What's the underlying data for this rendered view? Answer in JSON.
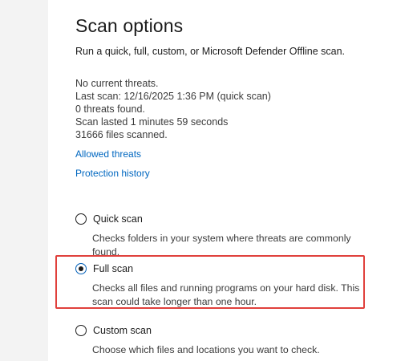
{
  "page": {
    "title": "Scan options",
    "subtitle": "Run a quick, full, custom, or Microsoft Defender Offline scan."
  },
  "status": {
    "lines": [
      "No current threats.",
      "Last scan: 12/16/2025 1:36 PM (quick scan)",
      "0 threats found.",
      "Scan lasted 1 minutes 59 seconds",
      "31666 files scanned."
    ]
  },
  "links": {
    "allowed_threats": "Allowed threats",
    "protection_history": "Protection history"
  },
  "options": [
    {
      "label": "Quick scan",
      "description": "Checks folders in your system where threats are commonly found.",
      "selected": false
    },
    {
      "label": "Full scan",
      "description": "Checks all files and running programs on your hard disk. This scan could take longer than one hour.",
      "selected": true
    },
    {
      "label": "Custom scan",
      "description": "Choose which files and locations you want to check.",
      "selected": false
    }
  ],
  "colors": {
    "link": "#0067c0",
    "highlight": "#e0403c",
    "radio_selected": "#005fb8"
  }
}
